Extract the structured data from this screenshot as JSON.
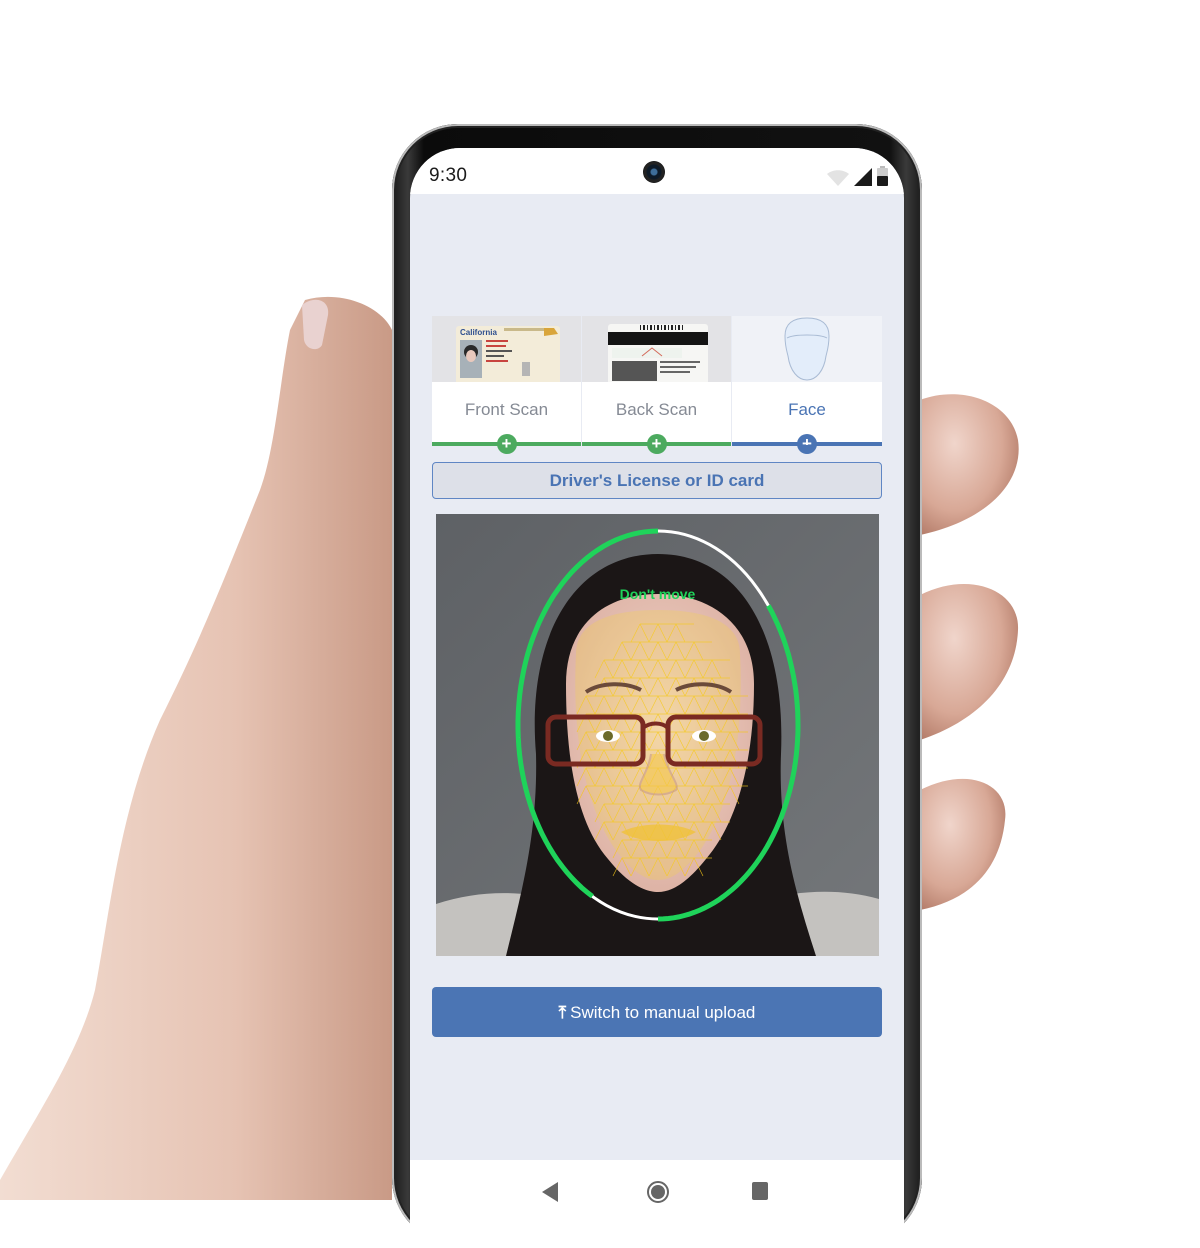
{
  "status_bar": {
    "time": "9:30",
    "icons": [
      "wifi-icon",
      "cellular-signal-icon",
      "battery-icon"
    ]
  },
  "steps": [
    {
      "label": "Front Scan",
      "state": "complete",
      "thumbnail": "id-card-front",
      "icon": "plus-icon"
    },
    {
      "label": "Back Scan",
      "state": "complete",
      "thumbnail": "id-card-back",
      "icon": "plus-icon"
    },
    {
      "label": "Face",
      "state": "active",
      "thumbnail": "face-silhouette",
      "icon": "plus-icon"
    }
  ],
  "document_type": {
    "label": "Driver's License or ID card"
  },
  "camera": {
    "guidance_text": "Don't move",
    "capture_progress_segments": [
      {
        "from_deg": 180,
        "to_deg": 312,
        "state": "complete"
      },
      {
        "from_deg": 0,
        "to_deg": 52,
        "state": "complete"
      }
    ]
  },
  "actions": {
    "manual_upload_label": "Switch to manual upload",
    "manual_upload_icon": "upload-icon"
  },
  "nav_bar": {
    "buttons": [
      "back-icon",
      "home-icon",
      "recents-icon"
    ]
  },
  "colors": {
    "accent_blue": "#4b75b4",
    "complete_green": "#4caa5f",
    "progress_green": "#1fd35a",
    "background": "#e8ebf3"
  }
}
